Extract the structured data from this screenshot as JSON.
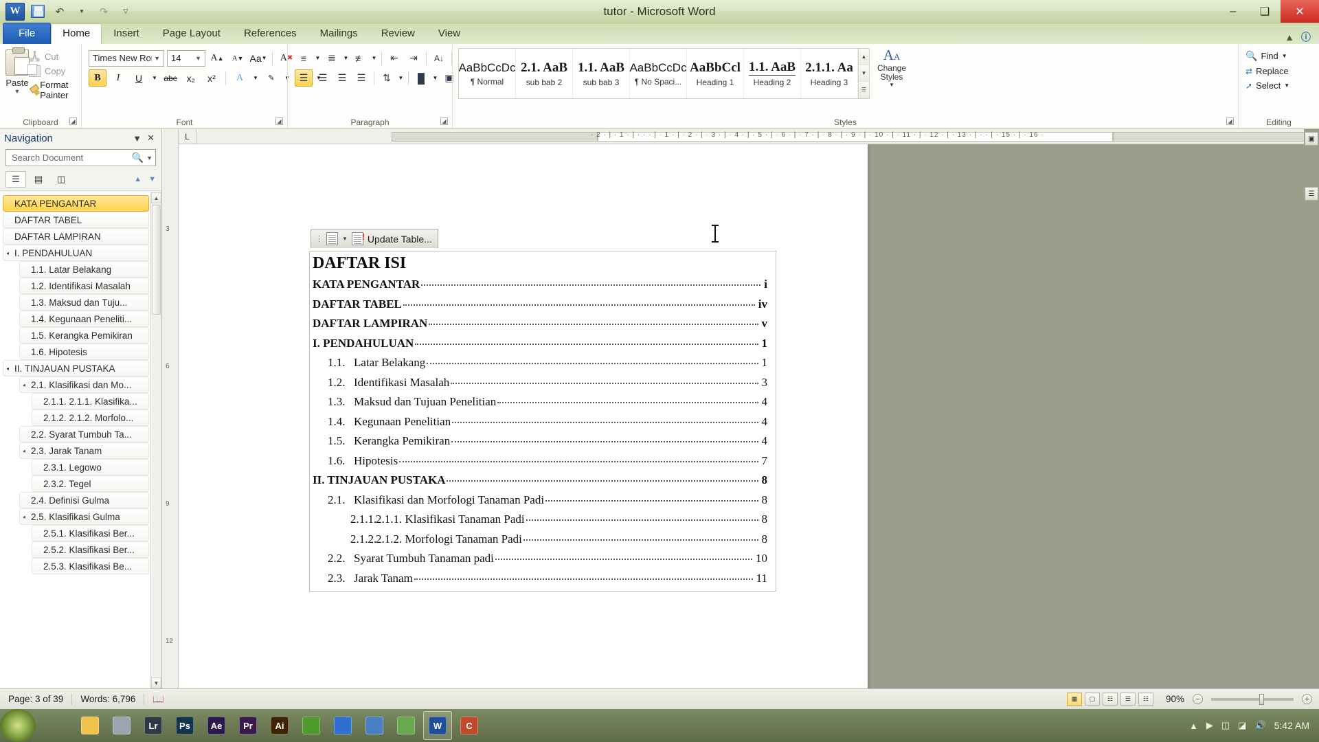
{
  "window": {
    "title": "tutor - Microsoft Word",
    "quick_access": [
      "save-icon",
      "undo-icon",
      "redo-icon",
      "customize-icon"
    ],
    "controls": {
      "minimize": "–",
      "restore": "❑",
      "close": "✕"
    }
  },
  "tabs": [
    {
      "label": "File",
      "type": "file"
    },
    {
      "label": "Home",
      "active": true
    },
    {
      "label": "Insert"
    },
    {
      "label": "Page Layout"
    },
    {
      "label": "References"
    },
    {
      "label": "Mailings"
    },
    {
      "label": "Review"
    },
    {
      "label": "View"
    }
  ],
  "ribbon": {
    "clipboard": {
      "group_label": "Clipboard",
      "paste_label": "Paste",
      "items": [
        {
          "label": "Cut",
          "icon": "scissors-icon",
          "enabled": false
        },
        {
          "label": "Copy",
          "icon": "copy-icon",
          "enabled": false
        },
        {
          "label": "Format Painter",
          "icon": "format-painter-icon",
          "enabled": true
        }
      ]
    },
    "font": {
      "group_label": "Font",
      "font_name": "Times New Rom",
      "font_size": "14",
      "grow_label": "A",
      "shrink_label": "A",
      "change_case": "Aa",
      "clear_format": "A",
      "bold": "B",
      "italic": "I",
      "underline": "U",
      "strike": "abc",
      "subscript": "x₂",
      "superscript": "x²",
      "text_effects": "A",
      "highlight": "ab",
      "font_color": "A",
      "bold_active": true
    },
    "paragraph": {
      "group_label": "Paragraph",
      "buttons": [
        "bullets-icon",
        "numbering-icon",
        "multilevel-list-icon",
        "decrease-indent-icon",
        "increase-indent-icon",
        "sort-icon",
        "show-marks-icon",
        "align-left-icon",
        "align-center-icon",
        "align-right-icon",
        "justify-icon",
        "line-spacing-icon",
        "shading-icon",
        "borders-icon"
      ]
    },
    "styles": {
      "group_label": "Styles",
      "items": [
        {
          "preview": "AaBbCcDc",
          "name": "¶ Normal",
          "serif": false
        },
        {
          "preview": "2.1. AaB",
          "name": "sub bab 2",
          "serif": true,
          "bold": true
        },
        {
          "preview": "1.1. AaB",
          "name": "sub bab 3",
          "serif": true,
          "bold": true
        },
        {
          "preview": "AaBbCcDc",
          "name": "¶ No Spaci...",
          "serif": false
        },
        {
          "preview": "AaBbCcl",
          "name": "Heading 1",
          "serif": true,
          "bold": true
        },
        {
          "preview": "1.1. AaB",
          "name": "Heading 2",
          "serif": true,
          "bold": true
        },
        {
          "preview": "2.1.1. Aa",
          "name": "Heading 3",
          "serif": true,
          "bold": true
        }
      ],
      "change_styles_label": "Change Styles"
    },
    "editing": {
      "group_label": "Editing",
      "items": [
        {
          "label": "Find",
          "icon": "find-icon"
        },
        {
          "label": "Replace",
          "icon": "replace-icon"
        },
        {
          "label": "Select",
          "icon": "select-icon"
        }
      ]
    }
  },
  "navigation": {
    "title": "Navigation",
    "search_placeholder": "Search Document",
    "tabs": [
      "headings-tab-icon",
      "pages-tab-icon",
      "results-tab-icon"
    ],
    "items": [
      {
        "label": "KATA PENGANTAR",
        "level": 1,
        "selected": true,
        "expandable": false
      },
      {
        "label": "DAFTAR TABEL",
        "level": 1,
        "expandable": false
      },
      {
        "label": "DAFTAR LAMPIRAN",
        "level": 1,
        "expandable": false
      },
      {
        "label": "I. PENDAHULUAN",
        "level": 1,
        "expandable": true
      },
      {
        "label": "1.1.  Latar Belakang",
        "level": 2,
        "expandable": false
      },
      {
        "label": "1.2.  Identifikasi Masalah",
        "level": 2,
        "expandable": false
      },
      {
        "label": "1.3.  Maksud dan Tuju...",
        "level": 2,
        "expandable": false
      },
      {
        "label": "1.4.  Kegunaan Peneliti...",
        "level": 2,
        "expandable": false
      },
      {
        "label": "1.5.  Kerangka Pemikiran",
        "level": 2,
        "expandable": false
      },
      {
        "label": "1.6.  Hipotesis",
        "level": 2,
        "expandable": false
      },
      {
        "label": "II. TINJAUAN PUSTAKA",
        "level": 1,
        "expandable": true
      },
      {
        "label": "2.1.  Klasifikasi dan Mo...",
        "level": 2,
        "expandable": true
      },
      {
        "label": "2.1.1. 2.1.1. Klasifika...",
        "level": 3,
        "expandable": false
      },
      {
        "label": "2.1.2. 2.1.2. Morfolo...",
        "level": 3,
        "expandable": false
      },
      {
        "label": "2.2.  Syarat Tumbuh Ta...",
        "level": 2,
        "expandable": false
      },
      {
        "label": "2.3. Jarak Tanam",
        "level": 2,
        "expandable": true
      },
      {
        "label": "2.3.1. Legowo",
        "level": 3,
        "expandable": false
      },
      {
        "label": "2.3.2. Tegel",
        "level": 3,
        "expandable": false
      },
      {
        "label": "2.4.  Definisi Gulma",
        "level": 2,
        "expandable": false
      },
      {
        "label": "2.5.  Klasifikasi Gulma",
        "level": 2,
        "expandable": true
      },
      {
        "label": "2.5.1. Klasifikasi Ber...",
        "level": 3,
        "expandable": false
      },
      {
        "label": "2.5.2. Klasifikasi Ber...",
        "level": 3,
        "expandable": false
      },
      {
        "label": "2.5.3. Klasifikasi Be...",
        "level": 3,
        "expandable": false
      }
    ]
  },
  "document": {
    "toc_toolbar": {
      "update_label": "Update Table...",
      "icon": "update-table-icon"
    },
    "toc_title": "DAFTAR ISI",
    "entries": [
      {
        "num": "",
        "label": "KATA PENGANTAR",
        "page": "i",
        "level": 0,
        "bold": true
      },
      {
        "num": "",
        "label": "DAFTAR TABEL",
        "page": "iv",
        "level": 0,
        "bold": true
      },
      {
        "num": "",
        "label": "DAFTAR LAMPIRAN",
        "page": "v",
        "level": 0,
        "bold": true
      },
      {
        "num": "",
        "label": "I. PENDAHULUAN",
        "page": "1",
        "level": 0,
        "bold": true
      },
      {
        "num": "1.1.",
        "label": "Latar Belakang",
        "page": "1",
        "level": 1,
        "bold": false
      },
      {
        "num": "1.2.",
        "label": "Identifikasi Masalah",
        "page": "3",
        "level": 1,
        "bold": false
      },
      {
        "num": "1.3.",
        "label": "Maksud dan Tujuan Penelitian",
        "page": "4",
        "level": 1,
        "bold": false
      },
      {
        "num": "1.4.",
        "label": "Kegunaan Penelitian",
        "page": "4",
        "level": 1,
        "bold": false
      },
      {
        "num": "1.5.",
        "label": "Kerangka Pemikiran",
        "page": "4",
        "level": 1,
        "bold": false
      },
      {
        "num": "1.6.",
        "label": "Hipotesis",
        "page": "7",
        "level": 1,
        "bold": false
      },
      {
        "num": "",
        "label": "II. TINJAUAN PUSTAKA",
        "page": "8",
        "level": 0,
        "bold": true
      },
      {
        "num": "2.1.",
        "label": "Klasifikasi dan Morfologi Tanaman Padi",
        "page": "8",
        "level": 1,
        "bold": false
      },
      {
        "num": "2.1.1.",
        "label": "2.1.1. Klasifikasi Tanaman Padi",
        "page": "8",
        "level": 2,
        "bold": false
      },
      {
        "num": "2.1.2.",
        "label": "2.1.2. Morfologi Tanaman Padi",
        "page": "8",
        "level": 2,
        "bold": false
      },
      {
        "num": "2.2.",
        "label": "Syarat Tumbuh Tanaman padi",
        "page": "10",
        "level": 1,
        "bold": false
      },
      {
        "num": "2.3.",
        "label": "Jarak Tanam",
        "page": "11",
        "level": 1,
        "bold": false
      }
    ],
    "ruler_text": "· 2 · | · 1 · | · · · | · 1 · | · 2 · | · 3 · | · 4 · | · 5 · | · 6 · | · 7 · | · 8 · | · 9 · | · 10 · | · 11 · | · 12 · | · 13 · | · · | · 15 · | · 16 ·",
    "vruler_marks": [
      "3",
      "6",
      "9",
      "12"
    ]
  },
  "statusbar": {
    "page": "Page: 3 of 39",
    "words": "Words: 6,796",
    "proofing_icon": "spell-check-icon",
    "view_buttons": [
      "print-layout-icon",
      "full-screen-icon",
      "web-layout-icon",
      "outline-icon",
      "draft-icon"
    ],
    "zoom": "90%",
    "zoom_out": "−",
    "zoom_in": "+"
  },
  "taskbar": {
    "start_icon": "windows-start-orb",
    "apps": [
      {
        "name": "explorer-icon",
        "label": "",
        "color": "#f0c24b"
      },
      {
        "name": "settings-icon",
        "label": "",
        "color": "#9aa5ad"
      },
      {
        "name": "lightroom-icon",
        "label": "Lr",
        "color": "#2b3a46"
      },
      {
        "name": "photoshop-icon",
        "label": "Ps",
        "color": "#12344d"
      },
      {
        "name": "aftereffects-icon",
        "label": "Ae",
        "color": "#2a1a4a"
      },
      {
        "name": "premiere-icon",
        "label": "Pr",
        "color": "#3a1a4a"
      },
      {
        "name": "illustrator-icon",
        "label": "Ai",
        "color": "#3d2400"
      },
      {
        "name": "leaf-icon",
        "label": "",
        "color": "#4f9a2f"
      },
      {
        "name": "chrome-icon",
        "label": "",
        "color": "#2f6fd0"
      },
      {
        "name": "folder-blue-icon",
        "label": "",
        "color": "#4a7fc1"
      },
      {
        "name": "app-green-icon",
        "label": "",
        "color": "#6aa84f"
      },
      {
        "name": "word-taskbar-icon",
        "label": "W",
        "color": "#1f4f9c"
      },
      {
        "name": "camtasia-icon",
        "label": "C",
        "color": "#c04a2a"
      }
    ],
    "tray": [
      "show-hidden-icon",
      "media-icon",
      "battery-icon",
      "network-icon",
      "volume-icon"
    ],
    "clock": "5:42 AM"
  }
}
